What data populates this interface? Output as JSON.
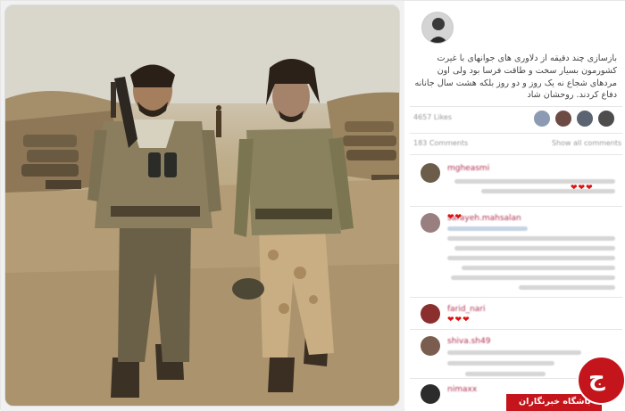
{
  "post": {
    "caption": "بازسازی چند دقیقه از دلاوری های جوانهای با غیرت کشورمون بسیار سخت و طاقت فرسا بود ولی اون مردهای شجاع نه یک روز و دو روز بلکه هشت سال جانانه دفاع کردند. روحشان شاد",
    "likes_label": "4657 Likes",
    "comments_label": "183 Comments",
    "show_all_label": "Show all comments"
  },
  "comments": [
    {
      "user": "mgheasmi",
      "hearts": "❤❤❤"
    },
    {
      "user": "sarayeh.mahsalan",
      "hearts": "❤❤"
    },
    {
      "user": "farid_nari",
      "hearts": "❤❤❤"
    },
    {
      "user": "shiva.sh49",
      "hearts": ""
    },
    {
      "user": "nimaxx",
      "hearts": ""
    }
  ],
  "watermark": {
    "text": "باشگاه خبرنگاران",
    "logo_letter": "ج"
  },
  "colors": {
    "accent": "#c4151c",
    "username": "#b03050",
    "photo_tone": "#b9a37b"
  }
}
